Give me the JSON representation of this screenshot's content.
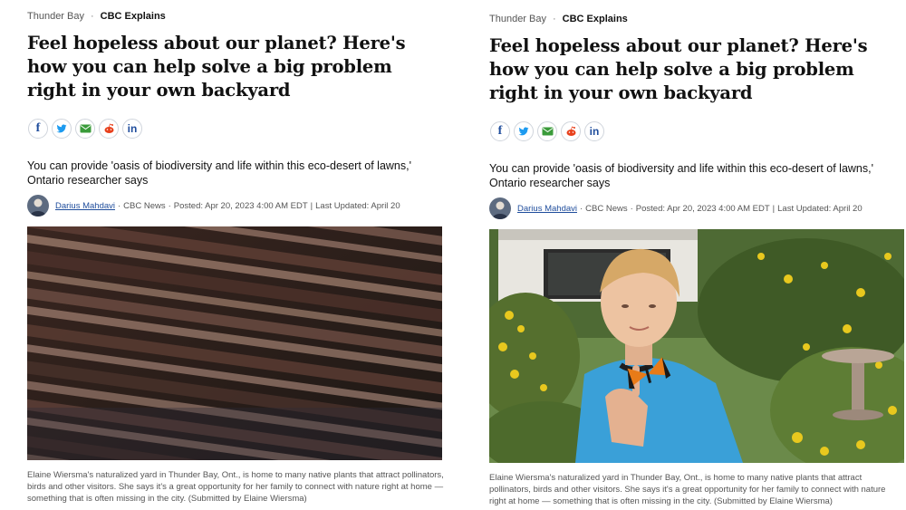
{
  "article": {
    "section": "Thunder Bay",
    "tag": "CBC Explains",
    "headline": "Feel hopeless about our planet? Here's how you can help solve a big problem right in your own backyard",
    "deck": "You can provide 'oasis of biodiversity and life within this eco-desert of lawns,' Ontario researcher says",
    "author": "Darius Mahdavi",
    "outlet": "CBC News",
    "posted": "Posted: Apr 20, 2023 4:00 AM EDT",
    "updated": "Last Updated: April 20",
    "caption": "Elaine Wiersma's naturalized yard in Thunder Bay, Ont., is home to many native plants that attract pollinators, birds and other visitors. She says it's a great opportunity for her family to connect with nature right at home — something that is often missing in the city. (Submitted by Elaine Wiersma)",
    "share_icons": [
      "facebook-icon",
      "twitter-icon",
      "email-icon",
      "reddit-icon",
      "linkedin-icon"
    ],
    "share_glyphs": {
      "facebook": "f",
      "linkedin": "in"
    }
  },
  "colors": {
    "link": "#1f4d9c",
    "twitter": "#1d9bf0",
    "email": "#3a9b3a",
    "reddit": "#e8401c"
  }
}
